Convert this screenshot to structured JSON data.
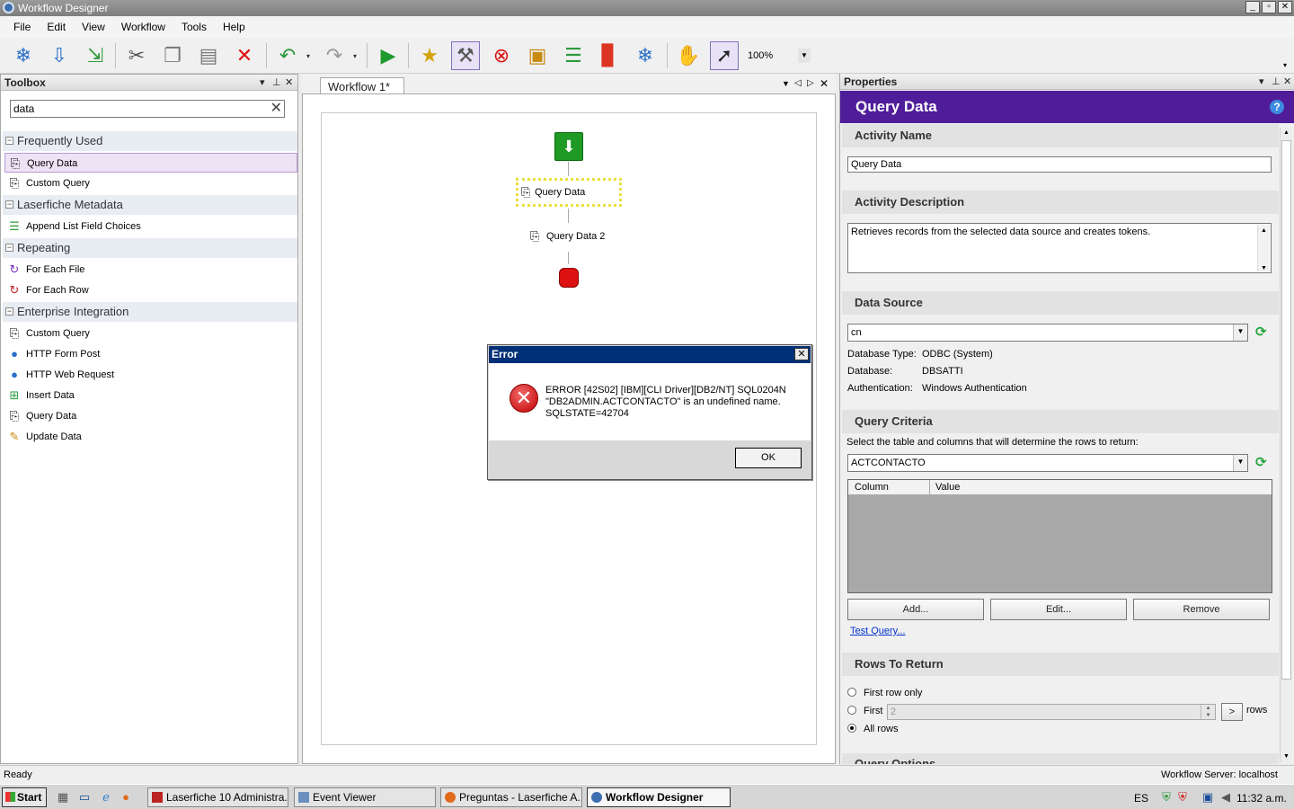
{
  "window": {
    "title": "Workflow Designer"
  },
  "menu": [
    "File",
    "Edit",
    "View",
    "Workflow",
    "Tools",
    "Help"
  ],
  "toolbar": {
    "zoom": "100%"
  },
  "toolbox": {
    "title": "Toolbox",
    "search_value": "data",
    "categories": [
      {
        "name": "Frequently Used",
        "items": [
          "Query Data",
          "Custom Query"
        ]
      },
      {
        "name": "Laserfiche Metadata",
        "items": [
          "Append List Field Choices"
        ]
      },
      {
        "name": "Repeating",
        "items": [
          "For Each File",
          "For Each Row"
        ]
      },
      {
        "name": "Enterprise Integration",
        "items": [
          "Custom Query",
          "HTTP Form Post",
          "HTTP Web Request",
          "Insert Data",
          "Query Data",
          "Update Data"
        ]
      }
    ]
  },
  "designer": {
    "tab": "Workflow 1*",
    "nodes": [
      "Query Data",
      "Query Data 2"
    ]
  },
  "properties": {
    "pane_title": "Properties",
    "activity_title": "Query Data",
    "sections": {
      "activity_name": "Activity Name",
      "activity_description": "Activity Description",
      "data_source": "Data Source",
      "query_criteria": "Query Criteria",
      "rows_to_return": "Rows To Return",
      "query_options": "Query Options"
    },
    "activity_name_value": "Query Data",
    "description_value": "Retrieves records from the selected data source and creates tokens.",
    "data_source_value": "cn",
    "db_type_label": "Database Type:",
    "db_type_value": "ODBC (System)",
    "database_label": "Database:",
    "database_value": "DBSATTI",
    "auth_label": "Authentication:",
    "auth_value": "Windows Authentication",
    "criteria_instruction": "Select the table and columns that will determine the rows to return:",
    "table_value": "ACTCONTACTO",
    "grid_columns": [
      "Column",
      "Value"
    ],
    "add_button": "Add...",
    "edit_button": "Edit...",
    "remove_button": "Remove",
    "test_query": "Test Query...",
    "first_row_only": "First row only",
    "first_label": "First",
    "first_value": "2",
    "stepper_btn": ">",
    "rows_label": "rows",
    "all_rows": "All rows"
  },
  "dialog": {
    "title": "Error",
    "message_line1": "ERROR [42S02] [IBM][CLI Driver][DB2/NT] SQL0204N",
    "message_line2": "\"DB2ADMIN.ACTCONTACTO\" is an undefined name.",
    "message_line3": "SQLSTATE=42704",
    "ok": "OK"
  },
  "status": {
    "left": "Ready",
    "right": "Workflow Server: localhost"
  },
  "taskbar": {
    "start": "Start",
    "tasks": [
      "Laserfiche 10 Administra...",
      "Event Viewer",
      "Preguntas - Laserfiche A...",
      "Workflow Designer"
    ],
    "lang": "ES",
    "clock": "11:32 a.m."
  }
}
